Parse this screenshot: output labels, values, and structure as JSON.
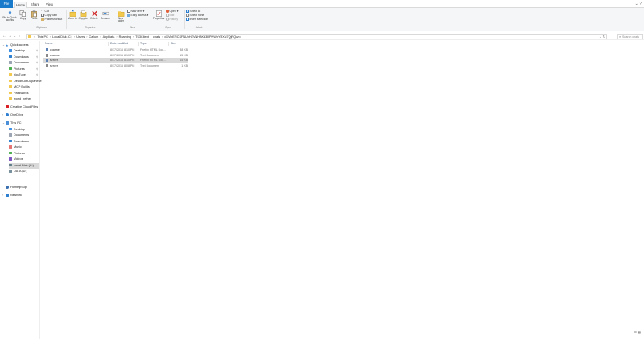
{
  "ribbon_tabs": {
    "file": "File",
    "home": "Home",
    "share": "Share",
    "view": "View"
  },
  "ribbon": {
    "pin": "Pin to Quick access",
    "copy": "Copy",
    "paste": "Paste",
    "cut": "Cut",
    "copy_path": "Copy path",
    "paste_shortcut": "Paste shortcut",
    "move_to": "Move to",
    "copy_to": "Copy to",
    "delete": "Delete",
    "rename": "Rename",
    "new_item": "New item",
    "easy_access": "Easy access",
    "new_folder": "New folder",
    "properties": "Properties",
    "open": "Open",
    "edit": "Edit",
    "history": "History",
    "select_all": "Select all",
    "select_none": "Select none",
    "invert_selection": "Invert selection",
    "groups": {
      "clipboard": "Clipboard",
      "organize": "Organize",
      "new": "New",
      "open": "Open",
      "select": "Select"
    }
  },
  "address": {
    "crumbs": [
      "This PC",
      "Local Disk (C:)",
      "Users",
      "Callum",
      "AppData",
      "Roaming",
      "TS3Client",
      "chats",
      "dXVibERCSFNUbHZVNHBKd3RPNWhYRXN7QjRQcz="
    ],
    "search_placeholder": "Search chats"
  },
  "nav": {
    "quick_access": "Quick access",
    "quick_items": [
      "Desktop",
      "Downloads",
      "Documents",
      "Pictures",
      "YouTube",
      "DeadrKothJapanese",
      "MCP Builds",
      "Passwords",
      "world_nether"
    ],
    "creative_cloud": "Creative Cloud Files",
    "onedrive": "OneDrive",
    "this_pc": "This PC",
    "pc_items": [
      "Desktop",
      "Documents",
      "Downloads",
      "Music",
      "Pictures",
      "Videos",
      "Local Disk (C:)",
      "DATA (D:)"
    ],
    "network": "Network",
    "homegroup": "Homegroup"
  },
  "columns": {
    "name": "Name",
    "date": "Date modified",
    "type": "Type",
    "size": "Size"
  },
  "files": [
    {
      "name": "channel",
      "date": "8/17/2016 8:10 PM",
      "type": "Firefox HTML Doc...",
      "size": "38 KB",
      "icon": "firefox-doc"
    },
    {
      "name": "channel",
      "date": "8/17/2016 8:10 PM",
      "type": "Text Document",
      "size": "15 KB",
      "icon": "text-doc"
    },
    {
      "name": "server",
      "date": "8/17/2016 8:10 PM",
      "type": "Firefox HTML Doc...",
      "size": "15 KB",
      "icon": "firefox-doc"
    },
    {
      "name": "server",
      "date": "8/17/2016 8:08 PM",
      "type": "Text Document",
      "size": "1 KB",
      "icon": "text-doc"
    }
  ]
}
